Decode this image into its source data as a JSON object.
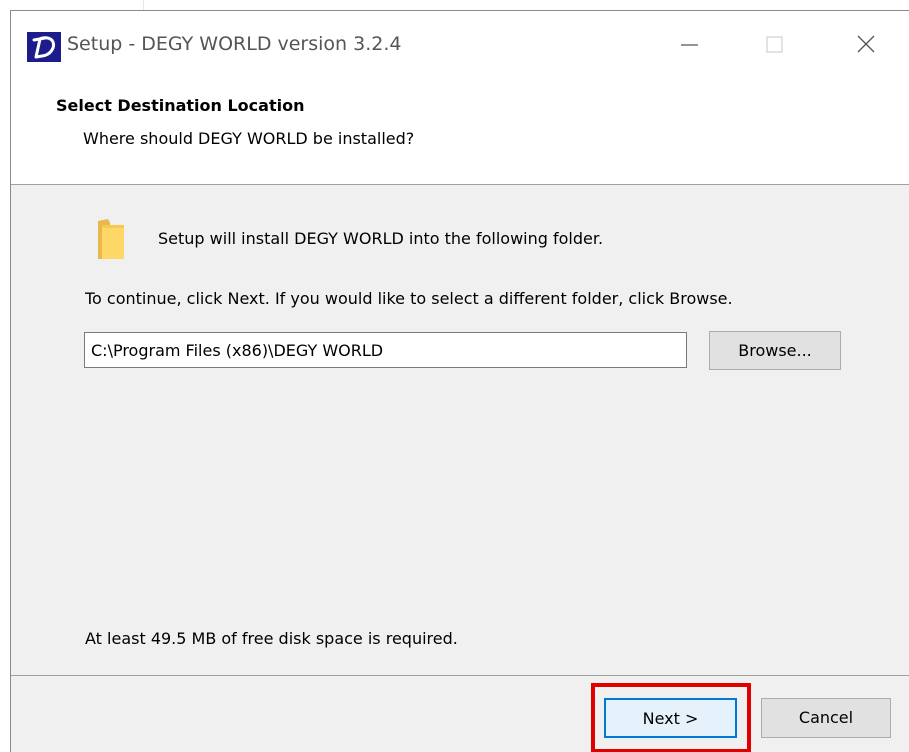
{
  "window": {
    "title": "Setup - DEGY WORLD version 3.2.4"
  },
  "header": {
    "title": "Select Destination Location",
    "subtitle": "Where should DEGY WORLD be installed?"
  },
  "body": {
    "intro": "Setup will install DEGY WORLD into the following folder.",
    "instruction": "To continue, click Next. If you would like to select a different folder, click Browse.",
    "path_value": "C:\\Program Files (x86)\\DEGY WORLD",
    "browse_label": "Browse...",
    "disk_space": "At least 49.5 MB of free disk space is required."
  },
  "footer": {
    "next_label": "Next >",
    "cancel_label": "Cancel"
  },
  "icons": {
    "app": "degy-d-logo-icon",
    "folder": "folder-icon",
    "minimize": "minimize-icon",
    "maximize": "maximize-icon",
    "close": "close-icon"
  },
  "colors": {
    "highlight": "#e00000",
    "default_button_border": "#0078d7",
    "dialog_background": "#f0f0f0"
  }
}
